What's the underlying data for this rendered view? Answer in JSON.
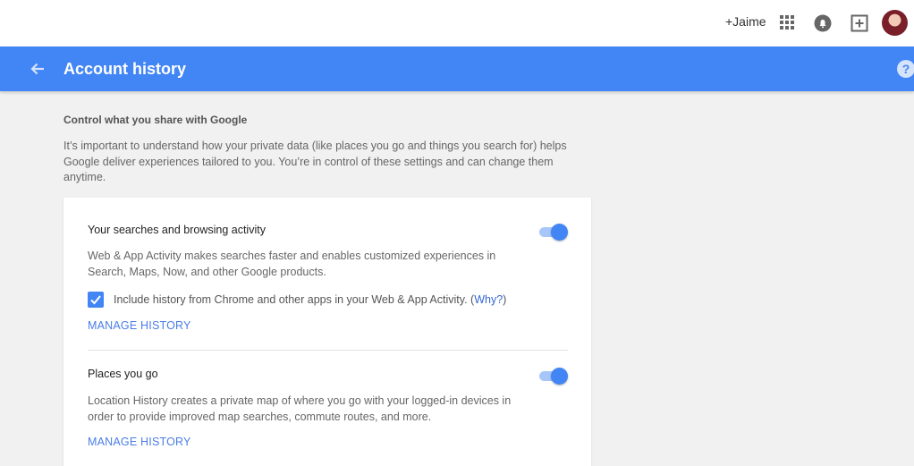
{
  "topbar": {
    "user_label": "+Jaime",
    "icons": [
      "apps-grid-icon",
      "notifications-bell-icon",
      "share-plus-icon"
    ]
  },
  "appbar": {
    "title": "Account history",
    "accent": "#4285f4"
  },
  "intro": {
    "heading": "Control what you share with Google",
    "text": "It’s important to understand how your private data (like places you go and things you search for) helps Google deliver experiences tailored to you. You’re in control of these settings and can change them anytime."
  },
  "settings": [
    {
      "title": "Your searches and browsing activity",
      "description": "Web & App Activity makes searches faster and enables customized experiences in Search, Maps, Now, and other Google products.",
      "enabled": true,
      "checkbox": {
        "checked": true,
        "label": "Include history from Chrome and other apps in your Web & App Activity. (",
        "link": "Why?",
        "suffix": ")"
      },
      "manage_label": "MANAGE HISTORY"
    },
    {
      "title": "Places you go",
      "description": "Location History creates a private map of where you go with your logged-in devices in order to provide improved map searches, commute routes, and more.",
      "enabled": true,
      "manage_label": "MANAGE HISTORY"
    }
  ]
}
